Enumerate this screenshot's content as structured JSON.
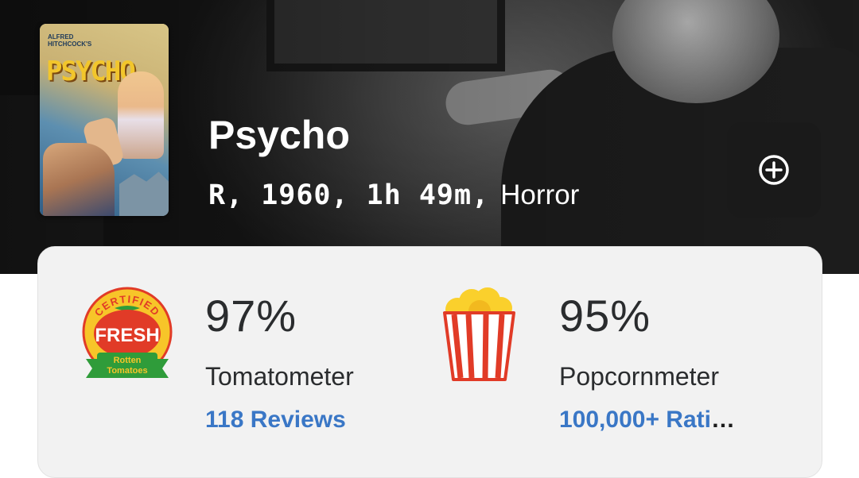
{
  "movie": {
    "title": "Psycho",
    "rating_year_runtime": "R, 1960, 1h 49m,",
    "genre": "Horror",
    "poster": {
      "small_text": "Alfred Hitchcock's",
      "title_text": "PSYCHO"
    }
  },
  "actions": {
    "add_icon": "plus-circle-icon"
  },
  "tomatometer": {
    "score": "97%",
    "label": "Tomatometer",
    "reviews_link": "118 Reviews",
    "badge": {
      "icon": "certified-fresh-icon",
      "top_text": "CERTIFIED",
      "main_text": "FRESH",
      "brand_line1": "Rotten",
      "brand_line2": "Tomatoes"
    }
  },
  "popcornmeter": {
    "score": "95%",
    "label": "Popcornmeter",
    "ratings_link": "100,000+ Rati",
    "ellipsis": "…",
    "icon": "popcorn-bucket-icon"
  },
  "colors": {
    "link": "#3a77c6",
    "score_text": "#2a2c2e",
    "tomato_red": "#e13b27",
    "fresh_yellow": "#f7c529",
    "leaf_green": "#2f9c3a",
    "card_bg": "#f2f2f2"
  }
}
